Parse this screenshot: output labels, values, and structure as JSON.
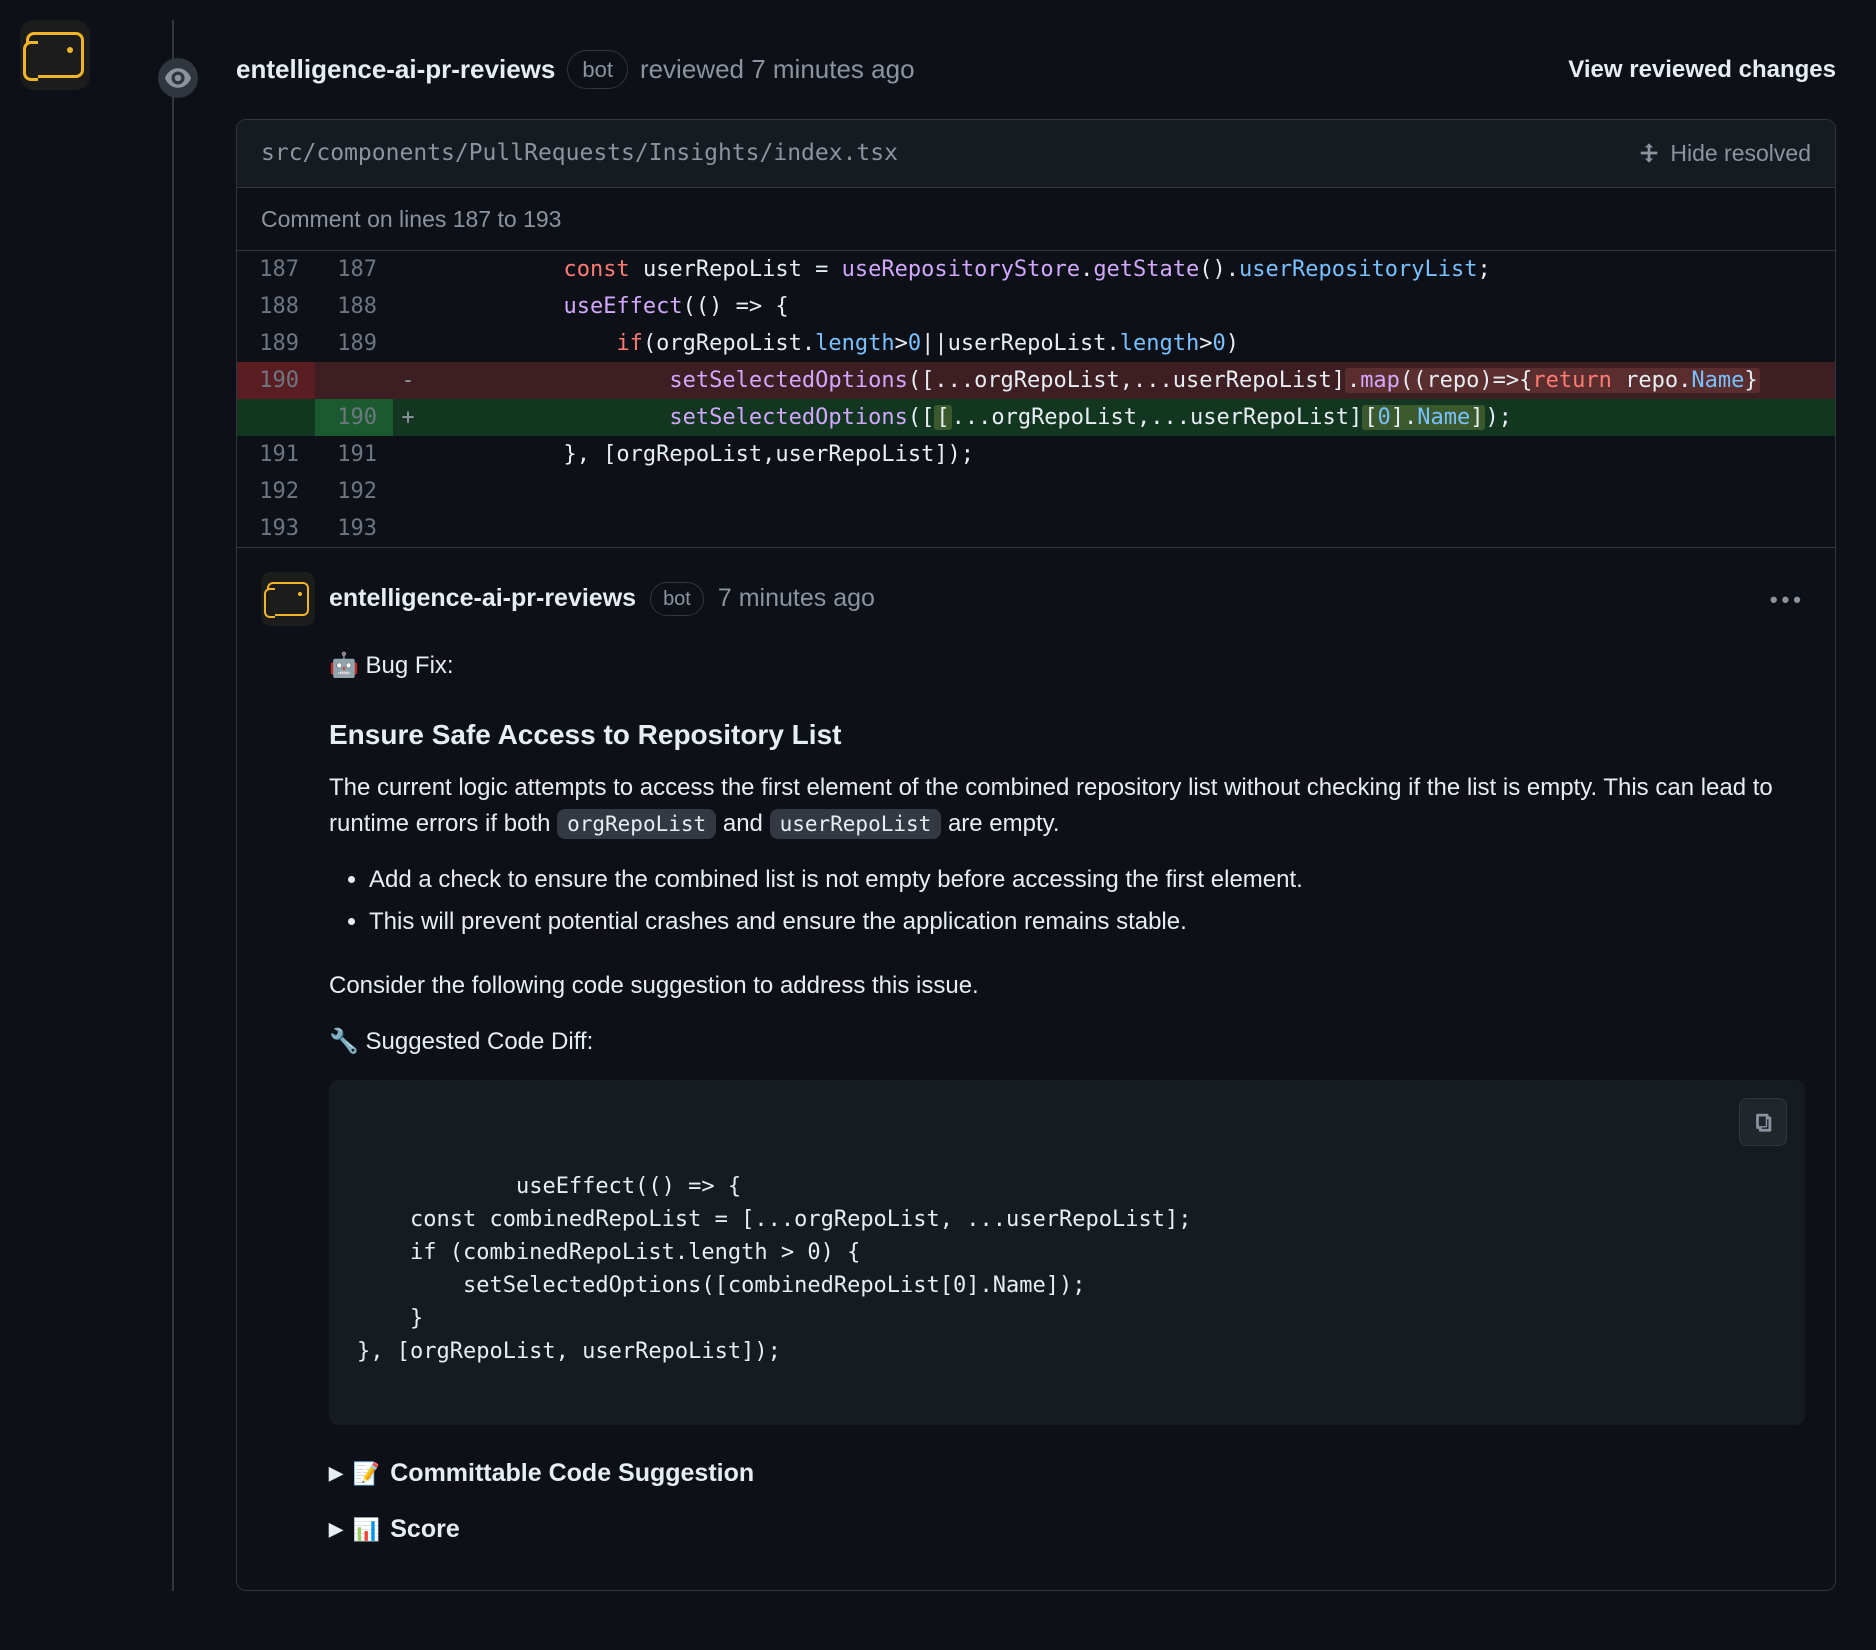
{
  "review": {
    "author": "entelligence-ai-pr-reviews",
    "bot_label": "bot",
    "action_text": "reviewed 7 minutes ago",
    "view_changes": "View reviewed changes"
  },
  "file": {
    "path": "src/components/PullRequests/Insights/index.tsx",
    "hide_resolved": "Hide resolved",
    "comment_range": "Comment on lines 187 to 193"
  },
  "diff": {
    "rows": [
      {
        "old": "187",
        "new": "187",
        "m": " ",
        "html": "          <span class='tok-kw'>const</span> <span class='tok-var'>userRepoList</span> = <span class='tok-fn'>useRepositoryStore</span>.<span class='tok-fn'>getState</span>().<span class='tok-prop'>userRepositoryList</span>;"
      },
      {
        "old": "188",
        "new": "188",
        "m": " ",
        "html": "          <span class='tok-fn'>useEffect</span>(() =&gt; {"
      },
      {
        "old": "189",
        "new": "189",
        "m": " ",
        "html": "              <span class='tok-kw'>if</span>(orgRepoList.<span class='tok-prop'>length</span>&gt;<span class='tok-num'>0</span>||userRepoList.<span class='tok-prop'>length</span>&gt;<span class='tok-num'>0</span>)"
      },
      {
        "old": "190",
        "new": "",
        "m": "-",
        "cls": "row-del",
        "html": "                  <span class='tok-fn'>setSelectedOptions</span>([...orgRepoList,...userRepoList]<span class='hl-del'>.<span class='tok-fn'>map</span>((<span class='tok-var'>repo</span>)=&gt;{<span class='tok-kw'>return</span> repo.<span class='tok-prop'>Name</span>}</span>"
      },
      {
        "old": "",
        "new": "190",
        "m": "+",
        "cls": "row-add",
        "html": "                  <span class='tok-fn'>setSelectedOptions</span>([<span class='hl'>[</span>...orgRepoList,...userRepoList]<span class='hl'>[<span class='tok-num'>0</span>].<span class='tok-prop'>Name</span>]</span>);"
      },
      {
        "old": "191",
        "new": "191",
        "m": " ",
        "html": "          }, [orgRepoList,userRepoList]);"
      },
      {
        "old": "192",
        "new": "192",
        "m": " ",
        "html": ""
      },
      {
        "old": "193",
        "new": "193",
        "m": " ",
        "html": ""
      }
    ]
  },
  "comment": {
    "author": "entelligence-ai-pr-reviews",
    "bot_label": "bot",
    "time": "7 minutes ago",
    "bugfix_label": "🤖 Bug Fix:",
    "heading": "Ensure Safe Access to Repository List",
    "body_pre": "The current logic attempts to access the first element of the combined repository list without checking if the list is empty. This can lead to runtime errors if both ",
    "code1": "orgRepoList",
    "body_mid": " and ",
    "code2": "userRepoList",
    "body_post": " are empty.",
    "bullets": [
      "Add a check to ensure the combined list is not empty before accessing the first element.",
      "This will prevent potential crashes and ensure the application remains stable."
    ],
    "consider": "Consider the following code suggestion to address this issue.",
    "suggested_label": "🔧 Suggested Code Diff:",
    "suggested_code": "useEffect(() => {\n    const combinedRepoList = [...orgRepoList, ...userRepoList];\n    if (combinedRepoList.length > 0) {\n        setSelectedOptions([combinedRepoList[0].Name]);\n    }\n}, [orgRepoList, userRepoList]);",
    "committable_label": "Committable Code Suggestion",
    "score_label": "Score"
  }
}
